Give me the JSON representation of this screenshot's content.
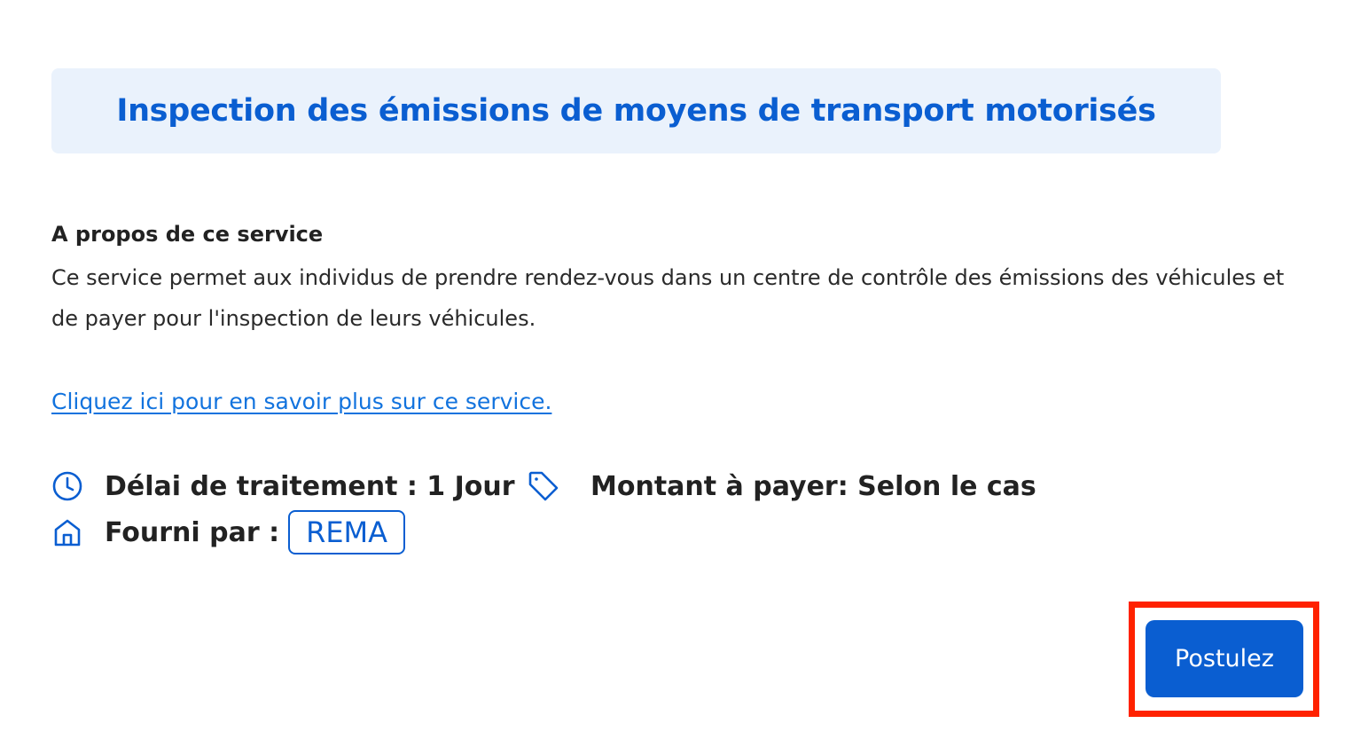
{
  "title": "Inspection des émissions de moyens de transport motorisés",
  "about": {
    "heading": "A propos de ce service",
    "text": "Ce service permet aux individus de prendre rendez-vous dans un centre de contrôle des émissions des véhicules et de payer pour l'inspection de leurs véhicules."
  },
  "learn_more_link": "Cliquez ici pour en savoir plus sur ce service.",
  "meta": {
    "processing_time": "Délai de traitement : 1 Jour",
    "amount": "Montant à payer: Selon le cas",
    "provided_by_label": "Fourni par :",
    "provider": "REMA",
    "icons": {
      "processing_time": "clock-icon",
      "amount": "tag-icon",
      "provided_by": "home-icon"
    }
  },
  "apply_button": "Postulez",
  "colors": {
    "accent": "#0a5ed1",
    "title_background": "#eaf2fc",
    "link": "#1273de",
    "highlight": "#ff2200"
  }
}
